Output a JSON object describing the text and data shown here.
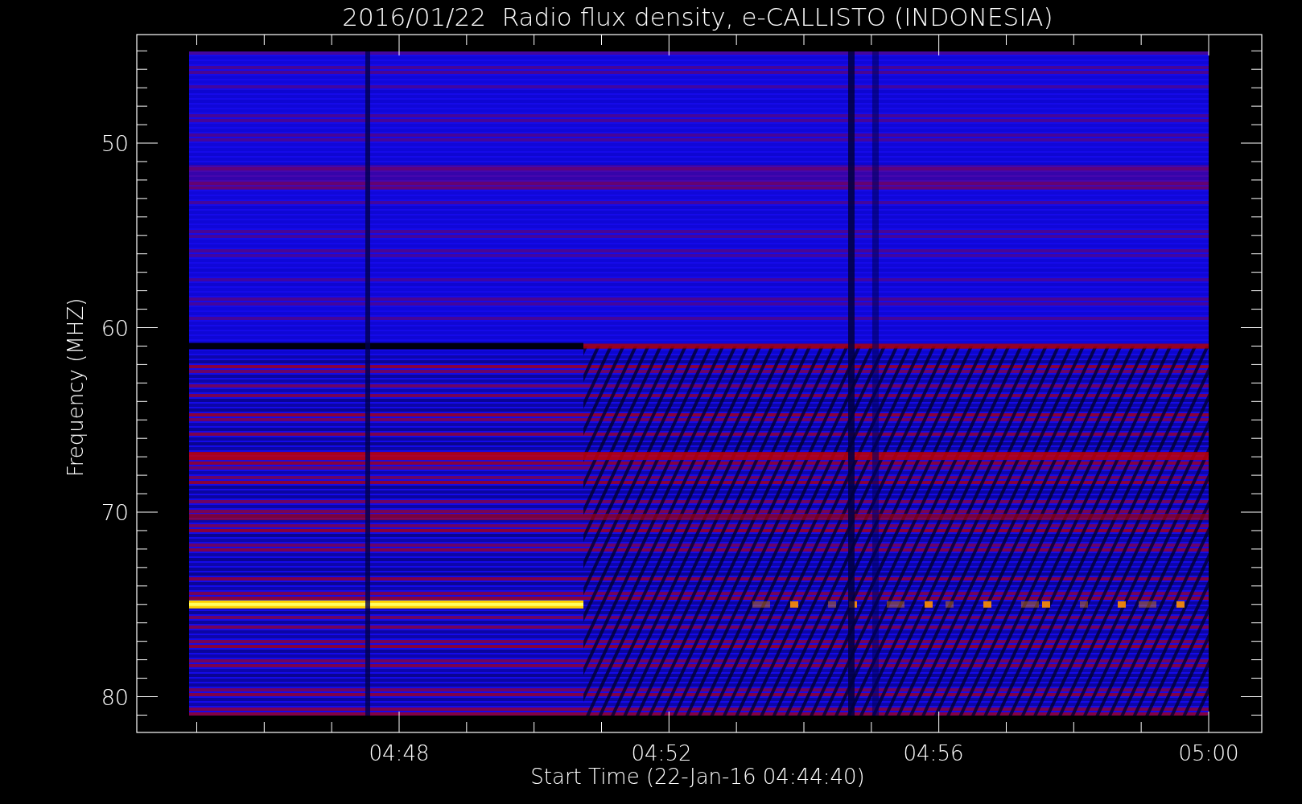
{
  "title": "2016/01/22  Radio flux density, e-CALLISTO (INDONESIA)",
  "y_axis": {
    "label": "Frequency (MHZ)",
    "ticks": [
      "50",
      "60",
      "70",
      "80"
    ]
  },
  "x_axis": {
    "label": "Start Time (22-Jan-16 04:44:40)",
    "ticks": [
      "04:48",
      "04:52",
      "04:56",
      "05:00"
    ]
  }
}
